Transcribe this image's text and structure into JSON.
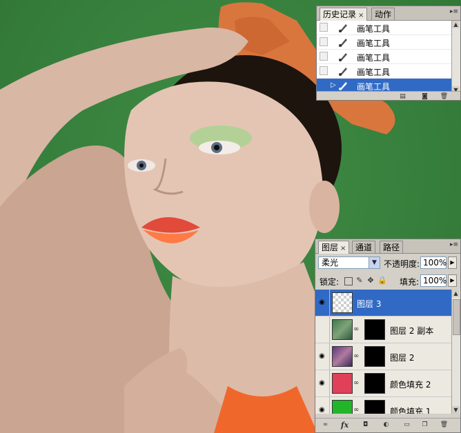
{
  "canvas": {
    "background": "#3a8740"
  },
  "history_panel": {
    "tabs": [
      {
        "label": "历史记录",
        "close": "×"
      },
      {
        "label": "动作"
      }
    ],
    "items": [
      {
        "label": "画笔工具",
        "icon": "brush-icon",
        "selected": false
      },
      {
        "label": "画笔工具",
        "icon": "brush-icon",
        "selected": false
      },
      {
        "label": "画笔工具",
        "icon": "brush-icon",
        "selected": false
      },
      {
        "label": "画笔工具",
        "icon": "brush-icon",
        "selected": false
      },
      {
        "label": "画笔工具",
        "icon": "brush-icon",
        "selected": true
      }
    ],
    "footer_icons": [
      "new-document-icon",
      "snapshot-icon",
      "trash-icon"
    ]
  },
  "layers_panel": {
    "tabs": [
      {
        "label": "图层",
        "close": "×"
      },
      {
        "label": "通道"
      },
      {
        "label": "路径"
      }
    ],
    "blend_mode": "柔光",
    "opacity_label": "不透明度:",
    "opacity_value": "100%",
    "lock_label": "锁定:",
    "fill_label": "填充:",
    "fill_value": "100%",
    "layers": [
      {
        "name": "图层 3",
        "visible": true,
        "selected": true,
        "thumb": "transparent",
        "mask": false
      },
      {
        "name": "图层 2 副本",
        "visible": false,
        "selected": false,
        "thumb": "photo",
        "mask": true
      },
      {
        "name": "图层 2",
        "visible": true,
        "selected": false,
        "thumb": "photo",
        "mask": true
      },
      {
        "name": "颜色填充 2",
        "visible": true,
        "selected": false,
        "thumb": "#e0405a",
        "mask": true
      },
      {
        "name": "颜色填充 1",
        "visible": true,
        "selected": false,
        "thumb": "#22b52a",
        "mask": true
      }
    ],
    "footer_icons": [
      "link-icon",
      "fx-icon",
      "mask-icon",
      "adjustment-icon",
      "folder-icon",
      "new-layer-icon",
      "trash-icon"
    ],
    "fx_label": "fx"
  },
  "colors": {
    "selection": "#316ac5",
    "panel_bg": "#d4d0c8"
  }
}
